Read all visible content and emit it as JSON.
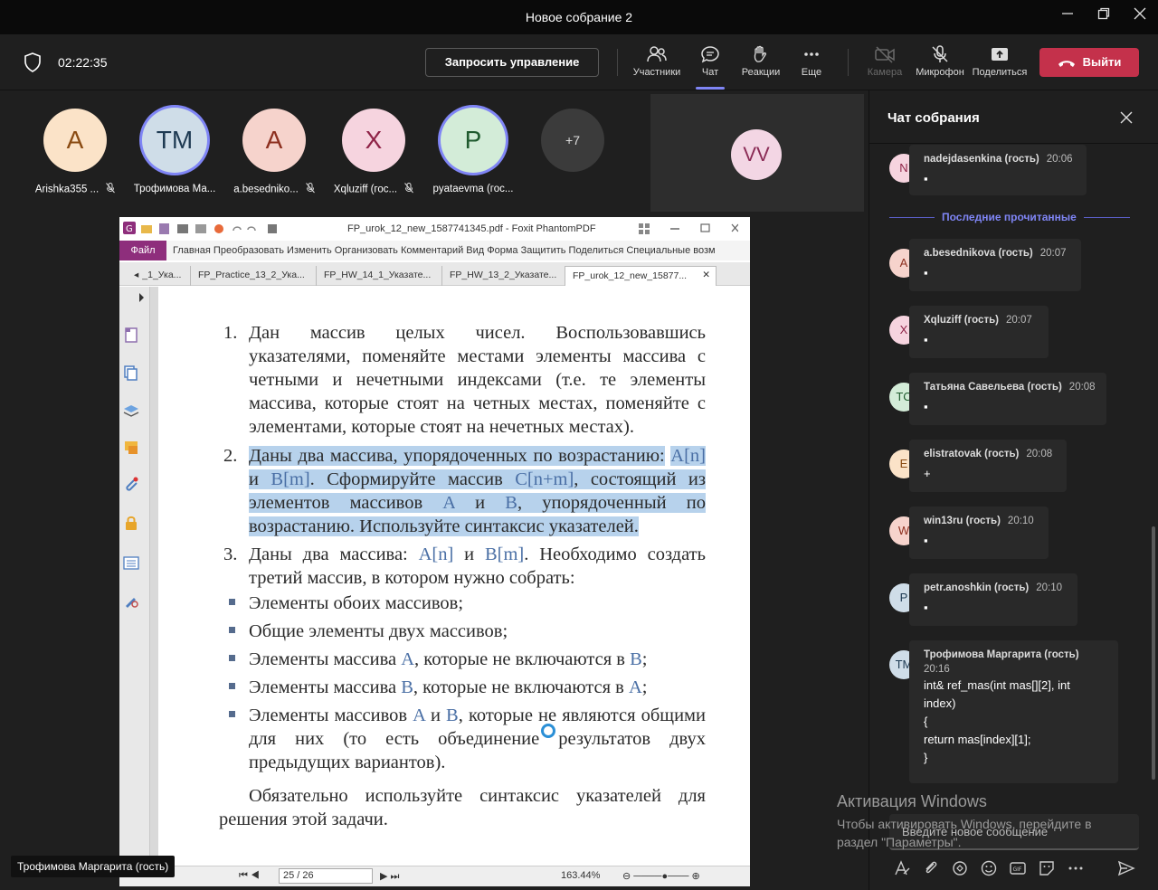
{
  "window": {
    "title": "Новое собрание 2"
  },
  "toolbar": {
    "timer": "02:22:35",
    "request_control": "Запросить управление",
    "participants_label": "Участники",
    "chat_label": "Чат",
    "reactions_label": "Реакции",
    "more_label": "Еще",
    "camera_label": "Камера",
    "mic_label": "Микрофон",
    "share_label": "Поделиться",
    "leave_label": "Выйти",
    "accent_color": "#7f85f5",
    "leave_color": "#c4314b"
  },
  "participants": [
    {
      "initials": "A",
      "name": "Arishka355 ..."
    },
    {
      "initials": "TM",
      "name": "Трофимова Ма..."
    },
    {
      "initials": "A",
      "name": "a.besedniko..."
    },
    {
      "initials": "X",
      "name": "Xqluziff (гос..."
    },
    {
      "initials": "P",
      "name": "pyataevma (гос..."
    }
  ],
  "more_participants": "+7",
  "video_tile": {
    "initials": "VV"
  },
  "presenter_tag": "Трофимова Маргарита (гость)",
  "pdf": {
    "title": "FP_urok_12_new_1587741345.pdf - Foxit PhantomPDF",
    "file_menu": "Файл",
    "menu": "Главная  Преобразовать  Изменить  Организовать  Комментарий  Вид  Форма  Защитить  Поделиться  Специальные возм",
    "tabs": [
      "_1_Ука...",
      "FP_Practice_13_2_Ука...",
      "FP_HW_14_1_Указате...",
      "FP_HW_13_2_Указате...",
      "FP_urok_12_new_15877..."
    ],
    "page": "25 / 26",
    "zoom": "163.44%",
    "content": {
      "q1_num": "1.",
      "q1": "Дан массив целых чисел. Воспользовавшись указателями, поменяйте местами элементы массива с четными и нечетными индексами (т.е. те элементы массива, которые стоят на четных местах, поменяйте с элементами, которые стоят на нечетных местах).",
      "q2_num": "2.",
      "q2_a": "Даны два массива, упорядоченных по возрастанию:",
      "q2_b1": "A[n]",
      "q2_b2": " и ",
      "q2_b3": "B[m]",
      "q2_b4": ". Сформируйте массив ",
      "q2_b5": "C[n+m]",
      "q2_b6": ", состоящий из элементов массивов ",
      "q2_b7": "A",
      "q2_b8": " и ",
      "q2_b9": "B",
      "q2_b10": ", упорядоченный по возрастанию. Используйте синтаксис указателей.",
      "q3_num": "3.",
      "q3_a": "Даны два массива: ",
      "q3_b": "A[n]",
      "q3_c": " и ",
      "q3_d": "B[m]",
      "q3_e": ". Необходимо создать третий массив, в котором нужно собрать:",
      "b1": "Элементы обоих массивов;",
      "b2": "Общие элементы двух массивов;",
      "b3_a": "Элементы массива ",
      "b3_b": "A",
      "b3_c": ", которые не включаются в ",
      "b3_d": "B",
      "b3_e": ";",
      "b4_a": "Элементы массива ",
      "b4_b": "B",
      "b4_c": ", которые не включаются в ",
      "b4_d": "A",
      "b4_e": ";",
      "b5_a": "Элементы массивов ",
      "b5_b": "A",
      "b5_c": " и ",
      "b5_d": "B",
      "b5_e": ", которые не являются общими для них (то есть объединение результатов двух предыдущих вариантов).",
      "final": "Обязательно используйте синтаксис указателей для решения этой задачи."
    }
  },
  "chat": {
    "title": "Чат собрания",
    "last_read": "Последние прочитанные",
    "placeholder": "Введите новое сообщение",
    "messages": [
      {
        "initials": "N",
        "author": "nadejdasenkina (гость)",
        "time": "20:06",
        "text": "▪"
      },
      {
        "initials": "A",
        "author": "a.besednikova (гость)",
        "time": "20:07",
        "text": "▪"
      },
      {
        "initials": "X",
        "author": "Xqluziff (гость)",
        "time": "20:07",
        "text": "▪"
      },
      {
        "initials": "TC",
        "author": "Татьяна Савельева (гость)",
        "time": "20:08",
        "text": "▪"
      },
      {
        "initials": "E",
        "author": "elistratovak (гость)",
        "time": "20:08",
        "text": "+"
      },
      {
        "initials": "W",
        "author": "win13ru (гость)",
        "time": "20:10",
        "text": "▪"
      },
      {
        "initials": "P",
        "author": "petr.anoshkin (гость)",
        "time": "20:10",
        "text": "▪"
      },
      {
        "initials": "TM",
        "author": "Трофимова Маргарита (гость)",
        "time": "20:16",
        "text": "int& ref_mas(int mas[][2], int\nindex)\n{\nreturn mas[index][1];\n}"
      }
    ]
  },
  "watermark": {
    "line1": "Активация Windows",
    "line2": "Чтобы активировать Windows, перейдите в раздел \"Параметры\"."
  }
}
